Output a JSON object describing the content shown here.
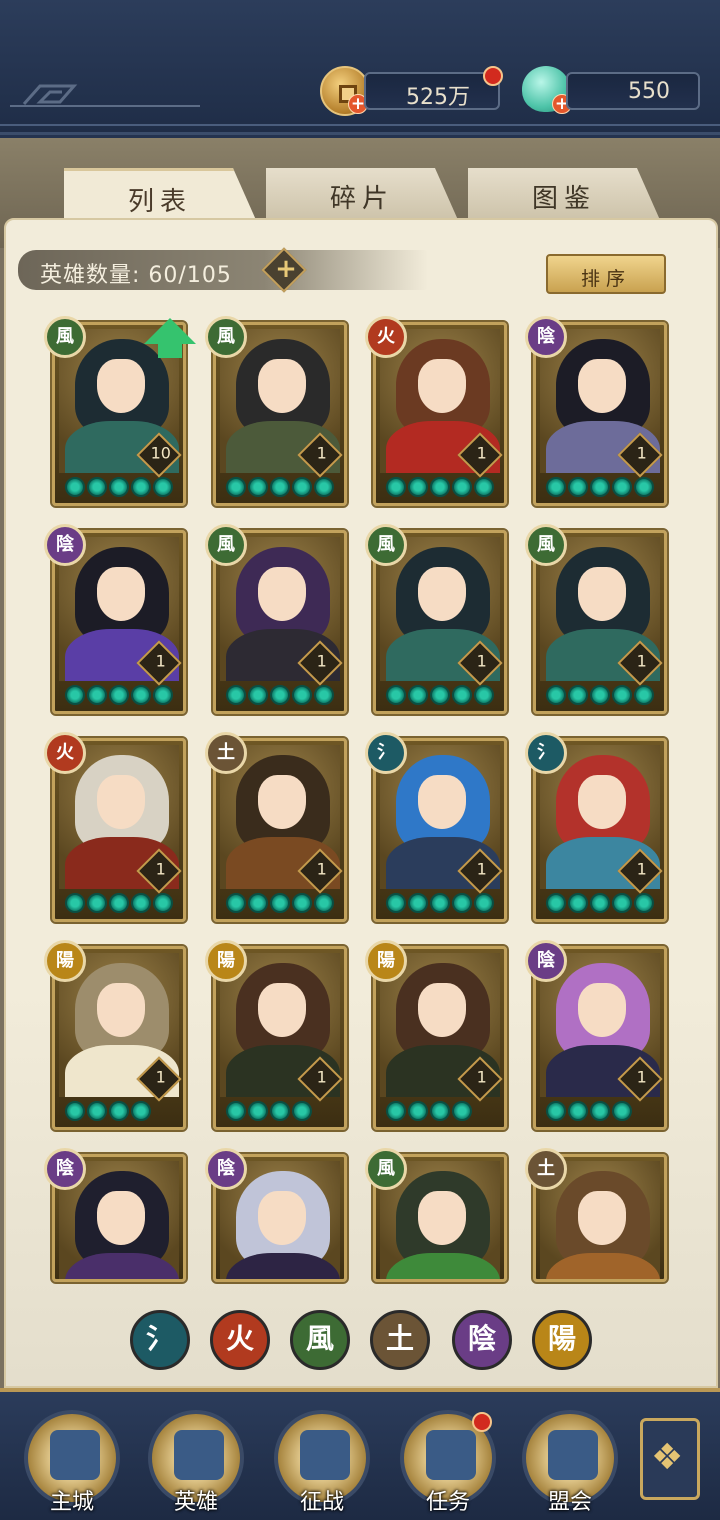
{
  "header": {
    "coins_value": "525万",
    "jade_value": "550"
  },
  "tabs": [
    {
      "label": "列表",
      "active": true
    },
    {
      "label": "碎片",
      "active": false
    },
    {
      "label": "图鉴",
      "active": false
    }
  ],
  "roster": {
    "count_label": "英雄数量:",
    "count_value": "60/105",
    "sort_label": "排序"
  },
  "elements": {
    "water": {
      "glyph": "氵",
      "color": "#1d5a64"
    },
    "fire": {
      "glyph": "火",
      "color": "#b13a1f"
    },
    "wind": {
      "glyph": "風",
      "color": "#3d6b34"
    },
    "earth": {
      "glyph": "土",
      "color": "#6b5436"
    },
    "yin": {
      "glyph": "陰",
      "color": "#6a3d86"
    },
    "yang": {
      "glyph": "陽",
      "color": "#b98618"
    }
  },
  "heroes": [
    {
      "element": "wind",
      "level": "10",
      "stars": 5,
      "upgrade": true,
      "hair": "#1d2c33",
      "robe": "#2f6a5f"
    },
    {
      "element": "wind",
      "level": "1",
      "stars": 5,
      "upgrade": false,
      "hair": "#2a2a2a",
      "robe": "#4c5a3a"
    },
    {
      "element": "fire",
      "level": "1",
      "stars": 5,
      "upgrade": false,
      "hair": "#6b3a22",
      "robe": "#b32a22"
    },
    {
      "element": "yin",
      "level": "1",
      "stars": 5,
      "upgrade": false,
      "hair": "#1c1c26",
      "robe": "#6d6c9a"
    },
    {
      "element": "yin",
      "level": "1",
      "stars": 5,
      "upgrade": false,
      "hair": "#1c1c26",
      "robe": "#5a3ea6"
    },
    {
      "element": "wind",
      "level": "1",
      "stars": 5,
      "upgrade": false,
      "hair": "#3e2a55",
      "robe": "#2d2a33"
    },
    {
      "element": "wind",
      "level": "1",
      "stars": 5,
      "upgrade": false,
      "hair": "#1d2c33",
      "robe": "#2f6a5f"
    },
    {
      "element": "wind",
      "level": "1",
      "stars": 5,
      "upgrade": false,
      "hair": "#1d2c33",
      "robe": "#2f6a5f"
    },
    {
      "element": "fire",
      "level": "1",
      "stars": 5,
      "upgrade": false,
      "hair": "#d8d2c4",
      "robe": "#8a2a1c"
    },
    {
      "element": "earth",
      "level": "1",
      "stars": 5,
      "upgrade": false,
      "hair": "#3a2c1c",
      "robe": "#7a4a22"
    },
    {
      "element": "water",
      "level": "1",
      "stars": 5,
      "upgrade": false,
      "hair": "#2f78c8",
      "robe": "#2b3d5c"
    },
    {
      "element": "water",
      "level": "1",
      "stars": 5,
      "upgrade": false,
      "hair": "#b3322b",
      "robe": "#3c86a0"
    },
    {
      "element": "yang",
      "level": "1",
      "stars": 4,
      "upgrade": false,
      "hair": "#9d8d6c",
      "robe": "#efe6cc"
    },
    {
      "element": "yang",
      "level": "1",
      "stars": 4,
      "upgrade": false,
      "hair": "#4a3020",
      "robe": "#2b3322"
    },
    {
      "element": "yang",
      "level": "1",
      "stars": 4,
      "upgrade": false,
      "hair": "#4a3020",
      "robe": "#2b3322"
    },
    {
      "element": "yin",
      "level": "1",
      "stars": 4,
      "upgrade": false,
      "hair": "#b070c4",
      "robe": "#2a2a4a"
    },
    {
      "element": "yin",
      "level": "",
      "stars": 0,
      "upgrade": false,
      "hair": "#1f1f2e",
      "robe": "#4a2f6a"
    },
    {
      "element": "yin",
      "level": "",
      "stars": 0,
      "upgrade": false,
      "hair": "#c0c4d8",
      "robe": "#2d2444"
    },
    {
      "element": "wind",
      "level": "",
      "stars": 0,
      "upgrade": false,
      "hair": "#2f3a2a",
      "robe": "#3e8a3a"
    },
    {
      "element": "earth",
      "level": "",
      "stars": 0,
      "upgrade": false,
      "hair": "#6a4a2a",
      "robe": "#a0642a"
    }
  ],
  "filters": [
    "water",
    "fire",
    "wind",
    "earth",
    "yin",
    "yang"
  ],
  "nav": [
    {
      "label": "主城",
      "icon": "palace-icon",
      "badge": false
    },
    {
      "label": "英雄",
      "icon": "hero-portrait-icon",
      "badge": false
    },
    {
      "label": "征战",
      "icon": "battle-icon",
      "badge": false
    },
    {
      "label": "任务",
      "icon": "scroll-icon",
      "badge": true
    },
    {
      "label": "盟会",
      "icon": "alliance-gate-icon",
      "badge": false
    }
  ]
}
